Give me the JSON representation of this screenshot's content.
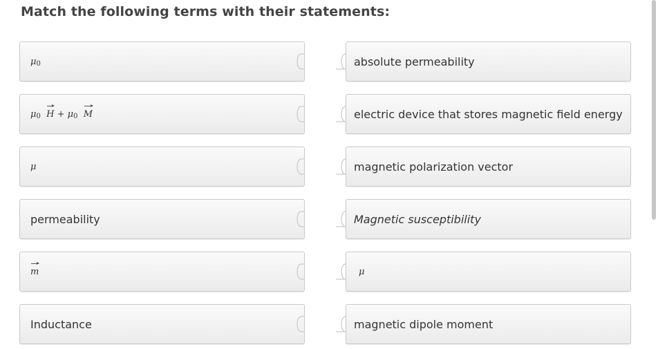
{
  "heading": "Match the following terms with their statements:",
  "terms": [
    {
      "id": "mu0",
      "label": "μ₀"
    },
    {
      "id": "mu0h-mu0m",
      "label": "μ₀ H⃗ + μ₀ M⃗"
    },
    {
      "id": "mu",
      "label": "μ"
    },
    {
      "id": "permeability",
      "label": "permeability"
    },
    {
      "id": "m-vector",
      "label": "m⃗"
    },
    {
      "id": "inductance",
      "label": "Inductance"
    }
  ],
  "statements": [
    {
      "id": "absolute-permeability",
      "label": "absolute permeability"
    },
    {
      "id": "electric-device",
      "label": "electric device that stores magnetic field energy"
    },
    {
      "id": "magnetic-polarization-vector",
      "label": "magnetic polarization vector"
    },
    {
      "id": "magnetic-susceptibility",
      "label": "Magnetic susceptibility"
    },
    {
      "id": "mu",
      "label": "μ"
    },
    {
      "id": "magnetic-dipole-moment",
      "label": "magnetic dipole moment"
    }
  ],
  "colors": {
    "tile_border": "#c9c9c9",
    "tile_bg": "#f2f2f2",
    "heading": "#444444"
  }
}
